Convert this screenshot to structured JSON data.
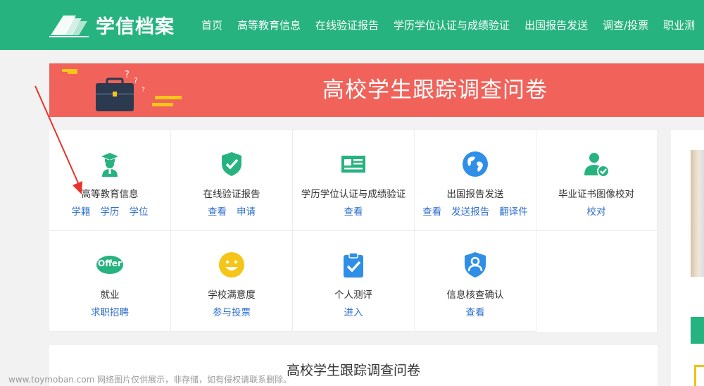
{
  "header": {
    "brand": "学信档案",
    "nav": [
      "首页",
      "高等教育信息",
      "在线验证报告",
      "学历学位认证与成绩验证",
      "出国报告发送",
      "调查/投票",
      "职业测"
    ]
  },
  "banner": {
    "title": "高校学生跟踪调查问卷"
  },
  "services": [
    {
      "name": "高等教育信息",
      "icon": "graduate-icon",
      "links": [
        "学籍",
        "学历",
        "学位"
      ]
    },
    {
      "name": "在线验证报告",
      "icon": "shield-check-icon",
      "links": [
        "查看",
        "申请"
      ]
    },
    {
      "name": "学历学位认证与成绩验证",
      "icon": "certificate-card-icon",
      "links": [
        "查看"
      ]
    },
    {
      "name": "出国报告发送",
      "icon": "globe-icon",
      "links": [
        "查看",
        "发送报告",
        "翻译件"
      ]
    },
    {
      "name": "毕业证书图像校对",
      "icon": "user-check-icon",
      "links": [
        "校对"
      ]
    },
    {
      "name": "就业",
      "icon": "offer-icon",
      "icon_text": "Offer",
      "links": [
        "求职招聘"
      ]
    },
    {
      "name": "学校满意度",
      "icon": "smiley-icon",
      "links": [
        "参与投票"
      ]
    },
    {
      "name": "个人测评",
      "icon": "clipboard-check-icon",
      "links": [
        "进入"
      ]
    },
    {
      "name": "信息核查确认",
      "icon": "user-shield-icon",
      "links": [
        "查看"
      ]
    }
  ],
  "survey": {
    "title": "高校学生跟踪调查问卷"
  },
  "watermark": "www.toymoban.com 网络图片仅供展示，非存储，如有侵权请联系删除。",
  "colors": {
    "brand_green": "#27b37f",
    "banner_red": "#f0625a",
    "link_blue": "#2e6fce",
    "icon_green": "#27b37f",
    "icon_blue": "#2f8fe6",
    "icon_yellow": "#f5c518"
  }
}
